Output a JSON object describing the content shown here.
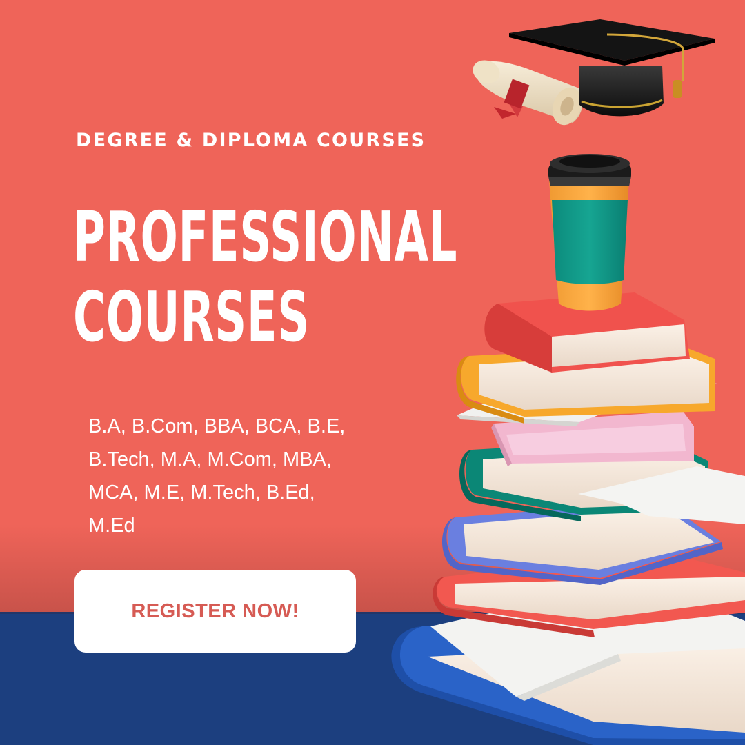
{
  "poster": {
    "subtitle": "DEGREE & DIPLOMA COURSES",
    "headline": [
      "PROFESSIONAL",
      "COURSES"
    ],
    "course_lines": [
      "B.A, B.Com, BBA, BCA, B.E,",
      "B.Tech, M.A, M.Com, MBA,",
      "MCA, M.E, M.Tech, B.Ed,",
      "M.Ed"
    ],
    "cta_label": "REGISTER NOW!"
  },
  "colors": {
    "background": "#ef6459",
    "floor": "#1c3f7f",
    "text": "#ffffff",
    "button_text": "#d65b54"
  },
  "icons": [
    "graduation-cap-icon",
    "diploma-scroll-icon",
    "coffee-cup-icon",
    "book-stack-icon"
  ]
}
